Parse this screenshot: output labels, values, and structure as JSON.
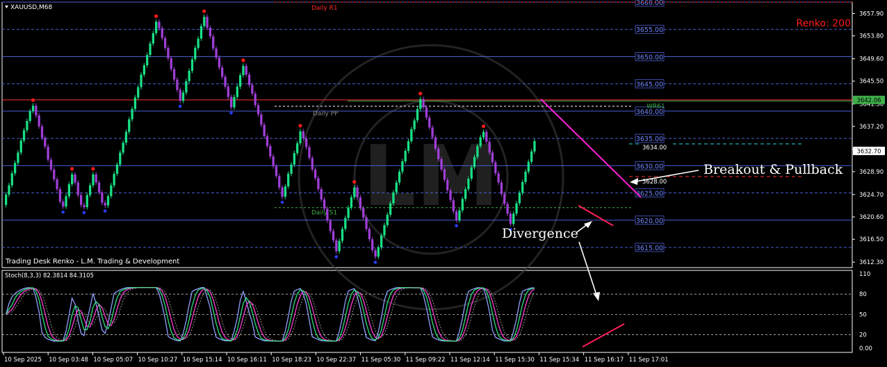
{
  "chart_data": {
    "type": "candlestick",
    "title": "XAUUSD,M68",
    "subtitle": "Trading Desk Renko - L.M. Trading & Development",
    "renko_label": "Renko: 200",
    "price_axis": {
      "range": [
        3611.3,
        3660
      ],
      "ticks": [
        3657.9,
        3653.8,
        3649.6,
        3645.5,
        3641.3,
        3637.2,
        3633.0,
        3628.9,
        3624.7,
        3620.6,
        3616.5,
        3612.3
      ],
      "tick_labels": [
        "3657.90",
        "3653.80",
        "3649.60",
        "3645.50",
        "3641.30",
        "3637.20",
        "3633.00",
        "3628.90",
        "3624.70",
        "3620.60",
        "3616.50",
        "3612.30"
      ],
      "current_price": "3632.70",
      "wr61_price": "3642.06"
    },
    "price_levels": [
      {
        "value": 3660.0,
        "label": "3660.00"
      },
      {
        "value": 3655.0,
        "label": "3655.00"
      },
      {
        "value": 3650.0,
        "label": "3650.00"
      },
      {
        "value": 3645.0,
        "label": "3645.00"
      },
      {
        "value": 3640.0,
        "label": "3640.00"
      },
      {
        "value": 3635.0,
        "label": "3635.00"
      },
      {
        "value": 3630.0,
        "label": "3630.00"
      },
      {
        "value": 3625.0,
        "label": "3625.00"
      },
      {
        "value": 3620.0,
        "label": "3620.00"
      },
      {
        "value": 3615.0,
        "label": "3615.00"
      }
    ],
    "pivot_labels": {
      "daily_r1": "Daily R1",
      "daily_pp": "Daily PP",
      "daily_s1": "Daily S1",
      "wr61": "WR61"
    },
    "pivot_values": {
      "daily_r1": 3660,
      "daily_pp": 3640.9,
      "daily_s1": 3622.3,
      "wr61": 3642.06
    },
    "trade_levels": [
      {
        "value": 3634.0,
        "label": "3634.00"
      },
      {
        "value": 3628.0,
        "label": "3628.00"
      }
    ],
    "annotations": {
      "breakout": "Breakout & Pullback",
      "divergence": "Divergence"
    },
    "stochastic": {
      "label": "Stoch(8,3,3) 82.3814 84.3105",
      "params": [
        8,
        3,
        3
      ],
      "main": 82.3814,
      "signal": 84.3105,
      "ticks": [
        110,
        80,
        50,
        20,
        0
      ],
      "tick_labels": [
        "110",
        "80",
        "50",
        "20",
        "0.00"
      ]
    },
    "x_labels": [
      "10 Sep 2025",
      "10 Sep 03:48",
      "10 Sep 05:07",
      "10 Sep 10:27",
      "10 Sep 15:14",
      "10 Sep 16:11",
      "10 Sep 18:23",
      "10 Sep 22:37",
      "11 Sep 05:30",
      "11 Sep 09:22",
      "11 Sep 12:14",
      "11 Sep 15:30",
      "11 Sep 15:34",
      "11 Sep 16:17",
      "11 Sep 17:01"
    ],
    "colors": {
      "bull": "#19e085",
      "bear": "#9f3fd6",
      "level": "#4a5fd0",
      "wr61": "#3fae49",
      "swing_high": "#ff1a1a",
      "swing_low": "#2a3cff",
      "trendline": "#ff1fd6",
      "divergence": "#ff1f5a",
      "stoch_main": "#8fa0ff",
      "stoch_signal": "#ff3fd6",
      "stoch_fast": "#30e080"
    },
    "bricks": "3624.7,3626.4,3628.6,3630.5,3632.4,3634.6,3636.5,3638.2,3640.0,3641.0,3639.2,3637.2,3635.1,3633.5,3631.1,3629.3,3627.5,3625.7,3623.4,3622.5,3624.4,3626.6,3628.4,3626.9,3624.6,3622.8,3622.4,3624.6,3626.4,3628.4,3626.9,3625.1,3623.2,3622.7,3624.4,3626.4,3628.5,3630.2,3632.4,3634.2,3636.2,3638.5,3640.4,3642.5,3644.4,3646.7,3648.4,3650.3,3652.4,3654.3,3656.4,3655.2,3653.4,3651.6,3649.7,3647.7,3645.8,3643.9,3641.9,3643.4,3645.5,3647.4,3649.5,3651.6,3653.3,3655.6,3657.3,3655.3,3653.7,3651.5,3649.8,3648.0,3646.3,3644.5,3642.6,3640.7,3642.6,3644.5,3646.6,3648.3,3646.7,3644.8,3643.2,3641.1,3639.4,3637.5,3635.4,3633.6,3631.7,3629.9,3628.1,3626.0,3624.3,3626.2,3628.5,3630.2,3632.3,3634.1,3636.3,3635.0,3633.4,3631.4,3629.3,3627.7,3625.7,3623.8,3622.1,3619.9,3618.0,3616.3,3614.3,3616.2,3618.4,3620.4,3622.3,3624.2,3626.0,3624.2,3622.2,3620.5,3618.4,3616.5,3614.5,3613.3,3615.0,3617.2,3619.1,3621.0,3623.1,3625.1,3626.9,3628.9,3630.8,3632.7,3634.5,3636.7,3638.3,3640.4,3642.2,3640.7,3638.8,3637.0,3635.2,3633.1,3631.2,3629.3,3627.4,3625.5,3623.7,3621.6,3620.0,3621.8,3623.9,3625.7,3627.6,3629.7,3631.6,3633.6,3635.2,3636.2,3634.4,3632.4,3630.6,3628.6,3626.9,3624.8,3623.0,3621.2,3619.3,3621.2,3623.1,3625.0,3627.0,3628.9,3630.7,3632.6,3634.5"
  }
}
